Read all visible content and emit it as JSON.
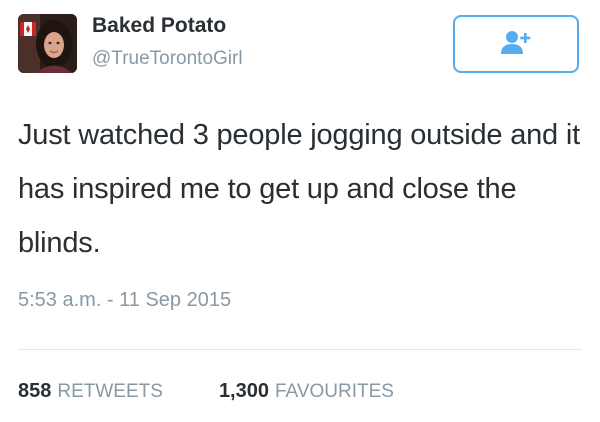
{
  "user": {
    "display_name": "Baked Potato",
    "handle": "@TrueTorontoGirl"
  },
  "follow_button": {
    "icon": "follow-user-icon"
  },
  "tweet": {
    "text": "Just watched 3 people jogging outside and it has inspired me to get up and close the blinds.",
    "timestamp": "5:53 a.m. - 11 Sep 2015"
  },
  "stats": {
    "retweets_count": "858",
    "retweets_label": "RETWEETS",
    "favourites_count": "1,300",
    "favourites_label": "FAVOURITES"
  },
  "colors": {
    "accent": "#55acee",
    "text": "#292f33",
    "muted": "#8899a6",
    "divider": "#e1e8ed"
  }
}
